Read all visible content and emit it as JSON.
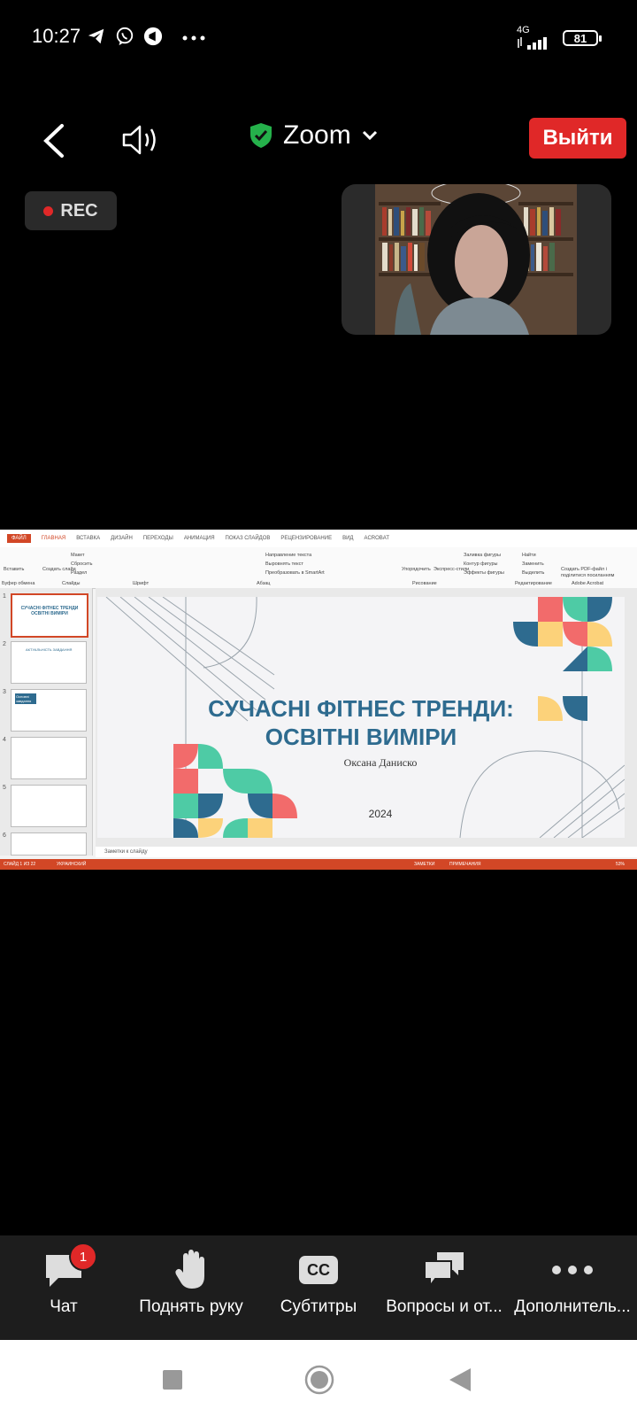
{
  "status_bar": {
    "time": "10:27",
    "network": "4G",
    "battery": "81"
  },
  "top_bar": {
    "app_title": "Zoom",
    "leave_label": "Выйти"
  },
  "recording": {
    "label": "REC"
  },
  "shared_screen": {
    "ribbon_tabs": [
      "ФАЙЛ",
      "ГЛАВНАЯ",
      "ВСТАВКА",
      "ДИЗАЙН",
      "ПЕРЕХОДЫ",
      "АНИМАЦИЯ",
      "ПОКАЗ СЛАЙДОВ",
      "РЕЦЕНЗИРОВАНИЕ",
      "ВИД",
      "ACROBAT"
    ],
    "ribbon_labels": [
      "Вставить",
      "Создать слайд",
      "Макет",
      "Сбросить",
      "Раздел",
      "Буфер обмена",
      "Слайды",
      "Шрифт",
      "Абзац",
      "Рисование",
      "Редактирование",
      "Adobe Acrobat",
      "Направление текста",
      "Выровнять текст",
      "Преобразовать в SmartArt",
      "Упорядочить",
      "Экспресс-стили",
      "Заливка фигуры",
      "Контур фигуры",
      "Эффекты фигуры",
      "Найти",
      "Заменить",
      "Выделить",
      "Создать PDF-файл і поділитися посиланням"
    ],
    "notes_placeholder": "Заметки к слайду",
    "status_left": "СЛАЙД 1 ИЗ 22",
    "status_lang": "УКРАИНСКИЙ",
    "status_right": [
      "ЗАМЕТКИ",
      "ПРИМЕЧАНИЯ"
    ],
    "zoom_level": "53%",
    "slide_numbers": [
      "1",
      "2",
      "3",
      "4",
      "5",
      "6"
    ],
    "thumb_titles": [
      "СУЧАСНІ ФІТНЕС ТРЕНДИ ОСВІТНІ ВИМІРИ",
      "АКТУАЛЬНІСТЬ ЗАВДАННЯ",
      "Основні завдання"
    ],
    "slide": {
      "title_line1": "СУЧАСНІ ФІТНЕС ТРЕНДИ:",
      "title_line2": "ОСВІТНІ ВИМІРИ",
      "author": "Оксана Даниско",
      "year": "2024"
    },
    "colors": {
      "teal": "#2e6b8f",
      "coral": "#f26b6b",
      "mint": "#4ecba5",
      "yellow": "#fcd27a",
      "orange_red": "#d24726"
    }
  },
  "toolbar": {
    "chat_label": "Чат",
    "chat_badge": "1",
    "raise_hand_label": "Поднять руку",
    "subtitles_label": "Субтитры",
    "subtitles_icon_text": "CC",
    "qa_label": "Вопросы и от...",
    "more_label": "Дополнитель..."
  },
  "icons": [
    "telegram-icon",
    "viber-icon",
    "notification-icon",
    "more-dots-icon",
    "signal-icon",
    "battery-icon",
    "back-chevron-icon",
    "speaker-icon",
    "shield-check-icon",
    "chevron-down-icon",
    "chat-icon",
    "hand-icon",
    "cc-icon",
    "qa-bubbles-icon",
    "more-icon",
    "nav-square-icon",
    "nav-home-icon",
    "nav-back-icon"
  ]
}
